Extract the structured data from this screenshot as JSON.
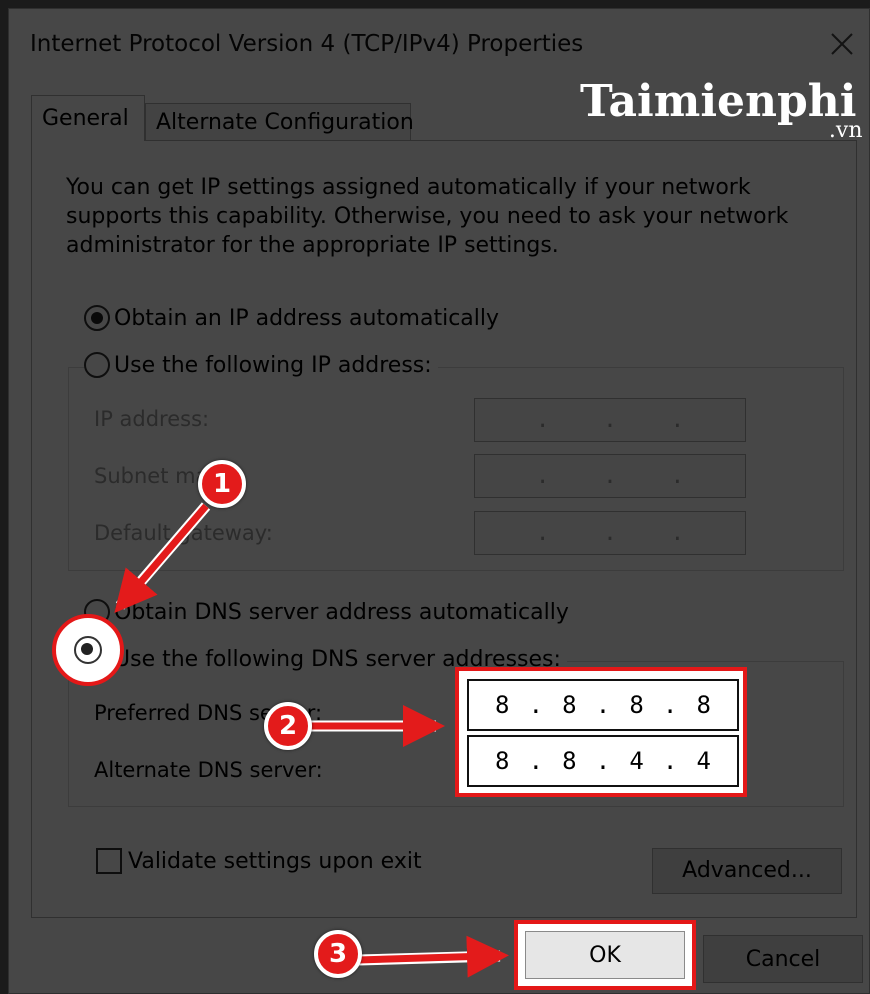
{
  "window": {
    "title": "Internet Protocol Version 4 (TCP/IPv4) Properties"
  },
  "tabs": [
    {
      "label": "General",
      "active": true
    },
    {
      "label": "Alternate Configuration",
      "active": false
    }
  ],
  "description": "You can get IP settings assigned automatically if your network supports this capability. Otherwise, you need to ask your network administrator for the appropriate IP settings.",
  "ip_mode": {
    "auto_label": "Obtain an IP address automatically",
    "manual_label": "Use the following IP address:",
    "selected": "auto"
  },
  "ip_fields": {
    "ip_address_label": "IP address:",
    "subnet_label": "Subnet mask:",
    "gateway_label": "Default gateway:",
    "empty_value": ".        .        ."
  },
  "dns_mode": {
    "auto_label": "Obtain DNS server address automatically",
    "manual_label": "Use the following DNS server addresses:",
    "selected": "manual"
  },
  "dns_fields": {
    "preferred_label": "Preferred DNS server:",
    "alternate_label": "Alternate DNS server:",
    "preferred_octets": [
      "8",
      "8",
      "8",
      "8"
    ],
    "alternate_octets": [
      "8",
      "8",
      "4",
      "4"
    ]
  },
  "validate": {
    "label": "Validate settings upon exit",
    "checked": false
  },
  "buttons": {
    "advanced": "Advanced...",
    "ok": "OK",
    "cancel": "Cancel"
  },
  "annotations": {
    "step1": "1",
    "step2": "2",
    "step3": "3"
  },
  "watermark": {
    "brand": "Taimienphi",
    "suffix": ".vn"
  },
  "colors": {
    "highlight": "#e41818",
    "badge": "#e31b1b"
  }
}
